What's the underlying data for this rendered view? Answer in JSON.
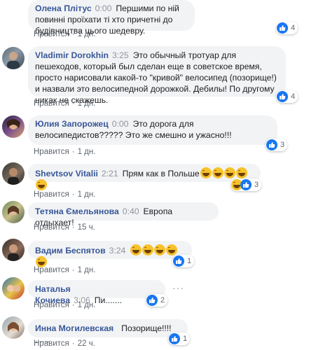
{
  "colors": {
    "author": "#385898",
    "bubble": "#f2f3f5",
    "like": "#1877f2",
    "haha": "#f7b928"
  },
  "actions": {
    "like_label": "Нравится"
  },
  "comments": [
    {
      "author": "Олена Плітус",
      "time": "0:00",
      "text": "Першими по ній повинні проїхати ті хто причетні до будівництва цього шедевру.",
      "ago": "1 дн.",
      "reactions": {
        "icons": [
          "like-icon"
        ],
        "count": "4"
      }
    },
    {
      "author": "Vladimir Dorokhin",
      "time": "3:25",
      "text": "Это обычный тротуар для пешеходов, который был сделан еще в советское время, просто нарисовали какой-то \"кривой\" велосипед (позорище!) и назвали это велосипедной дорожкой. Дебилы! По другому никак не скажешь.",
      "ago": "1 дн.",
      "reactions": {
        "icons": [
          "like-icon"
        ],
        "count": "4"
      }
    },
    {
      "author": "Юлия Запорожец",
      "time": "0:00",
      "text": "Это дорога для велосипедистов????? Это же смешно и ужасно!!!",
      "ago": "1 дн.",
      "reactions": {
        "icons": [
          "like-icon"
        ],
        "count": "3"
      }
    },
    {
      "author": "Shevtsov Vitalii",
      "time": "2:21",
      "text": "Прям как в Польше",
      "emoji_count": 5,
      "ago": "1 дн.",
      "reactions": {
        "icons": [
          "haha-icon",
          "like-icon"
        ],
        "count": "3"
      }
    },
    {
      "author": "Тетяна Ємельянова",
      "time": "0:40",
      "text": "Европа отдыхает!",
      "ago": "15 ч."
    },
    {
      "author": "Вадим Беспятов",
      "time": "3:24",
      "text": "",
      "emoji_count": 5,
      "ago": "1 дн.",
      "reactions": {
        "icons": [
          "like-icon"
        ],
        "count": "1"
      }
    },
    {
      "author": "Наталья Кочиева",
      "time": "3:06",
      "text": "Пи.......",
      "ago": "1 дн.",
      "reactions": {
        "icons": [
          "like-icon"
        ],
        "count": "2"
      }
    },
    {
      "author": "Инна Могилевская",
      "time": "",
      "text": "Позорище!!!! ......",
      "ago": "22 ч.",
      "reactions": {
        "icons": [
          "like-icon"
        ],
        "count": "1"
      }
    }
  ]
}
